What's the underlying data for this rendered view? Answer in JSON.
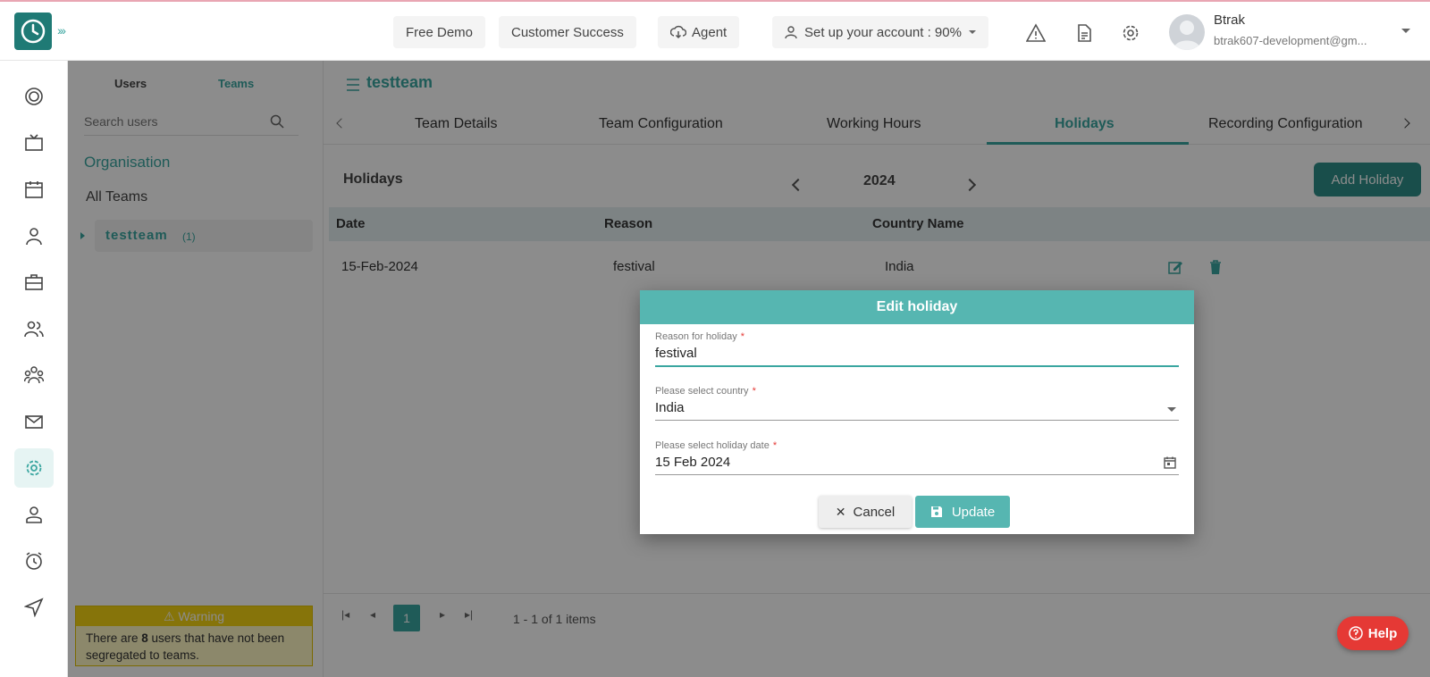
{
  "topbar": {
    "free_demo": "Free Demo",
    "customer_success": "Customer Success",
    "agent": "Agent",
    "setup": "Set up your account : 90%",
    "user_name": "Btrak",
    "user_email": "btrak607-development@gm..."
  },
  "left_panel": {
    "tab_users": "Users",
    "tab_teams": "Teams",
    "search_placeholder": "Search users",
    "organisation": "Organisation",
    "all_teams": "All Teams",
    "team_name": "testteam",
    "team_count": "(1)",
    "warning_title": "Warning",
    "warning_pre": "There are ",
    "warning_count": "8",
    "warning_post": " users that have not been segregated to teams."
  },
  "main": {
    "title": "testteam",
    "tabs": [
      "Team Details",
      "Team Configuration",
      "Working Hours",
      "Holidays",
      "Recording Configuration"
    ],
    "section_title": "Holidays",
    "year": "2024",
    "add_button": "Add Holiday",
    "columns": [
      "Date",
      "Reason",
      "Country Name"
    ],
    "rows": [
      {
        "date": "15-Feb-2024",
        "reason": "festival",
        "country": "India"
      }
    ],
    "pager": {
      "page": "1",
      "info": "1 - 1 of 1 items"
    }
  },
  "dialog": {
    "title": "Edit holiday",
    "reason_label": "Reason for holiday",
    "reason_value": "festival",
    "country_label": "Please select country",
    "country_value": "India",
    "date_label": "Please select holiday date",
    "date_value": "15 Feb 2024",
    "cancel": "Cancel",
    "update": "Update",
    "required_mark": "*"
  },
  "help": "Help",
  "colors": {
    "accent": "#3aa6a0",
    "dialog_header": "#56b6b1",
    "help": "#e53935",
    "warning": "#f4d313"
  }
}
